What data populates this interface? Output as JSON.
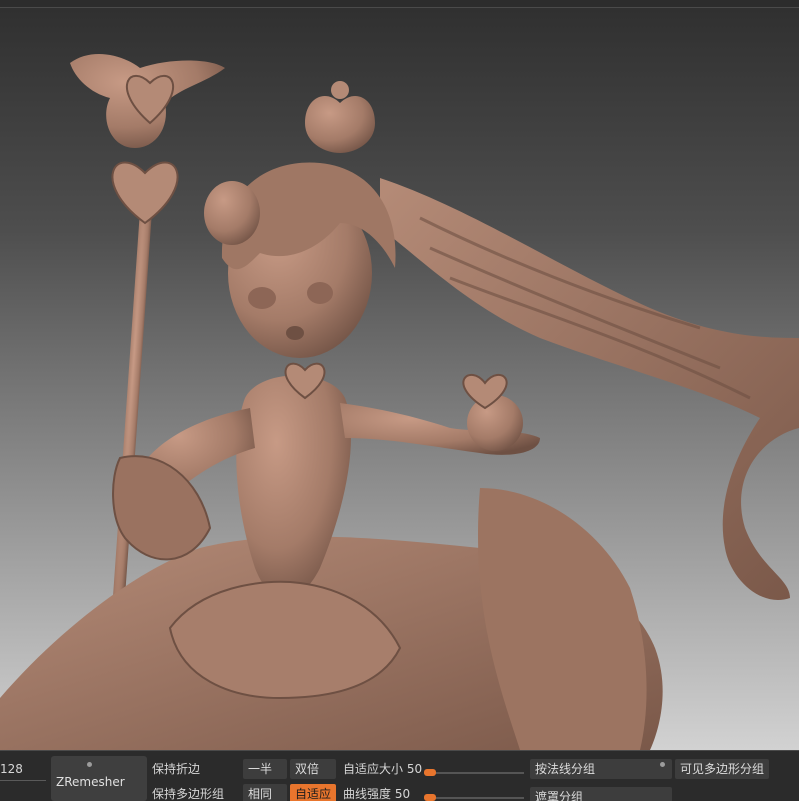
{
  "viewport": {
    "subject": "sculpted-figure-preview",
    "background_top": "#303030",
    "background_bottom": "#d2d2d2",
    "clay_color": "#a67d6a"
  },
  "zremesher": {
    "target_count": "128",
    "label": "ZRemesher",
    "keep_creases": "保持折边",
    "keep_groups": "保持多边形组",
    "half": "一半",
    "same": "相同",
    "double": "双倍",
    "adapt": "自适应",
    "adaptive_size_label": "自适应大小",
    "adaptive_size_value": "50",
    "curve_strength_label": "曲线强度",
    "curve_strength_value": "50",
    "by_normals": "按法线分组",
    "visible_polygroups": "可见多边形分组",
    "mask_groups": "遮罩分组"
  }
}
